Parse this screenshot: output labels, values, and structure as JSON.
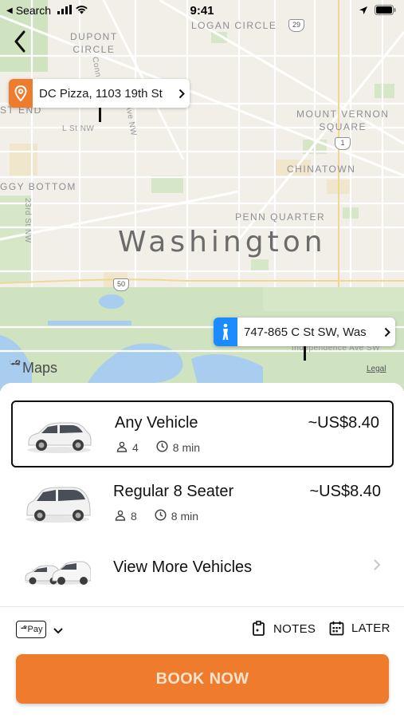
{
  "status_bar": {
    "back_app": "Search",
    "time": "9:41"
  },
  "map": {
    "city": "Washington",
    "neighborhoods": {
      "dupont": "DUPONT\nCIRCLE",
      "logan": "LOGAN CIRCLE",
      "mount_vernon": "MOUNT VERNON\nSQUARE",
      "chinatown": "CHINATOWN",
      "penn_quarter": "PENN QUARTER",
      "foggy_bottom": "GGY BOTTOM",
      "west_end": "ST END"
    },
    "streets": {
      "l_st": "L St NW",
      "conn_ave": "Conn",
      "vt_ave": "Ave NW",
      "twentythird": "23rd St NW",
      "independence": "Independence Ave SW"
    },
    "highways": {
      "hwy29": "29",
      "hwy1": "1",
      "hwy50": "50"
    },
    "attribution": "Maps",
    "legal": "Legal"
  },
  "pickup": {
    "address": "DC Pizza, 1103 19th St",
    "color": "#ef7b2d"
  },
  "dropoff": {
    "address": "747-865 C St SW, Was",
    "color": "#1a8cff"
  },
  "vehicles": [
    {
      "name": "Any Vehicle",
      "price": "~US$8.40",
      "seats": "4",
      "eta": "8 min"
    },
    {
      "name": "Regular 8 Seater",
      "price": "~US$8.40",
      "seats": "8",
      "eta": "8 min"
    }
  ],
  "more_vehicles": "View More Vehicles",
  "payment": {
    "method": "Pay"
  },
  "options": {
    "notes": "NOTES",
    "later": "LATER"
  },
  "book_now": "BOOK NOW",
  "colors": {
    "accent": "#ef7b2d",
    "pickup": "#ef7b2d",
    "dropoff": "#1a8cff"
  }
}
